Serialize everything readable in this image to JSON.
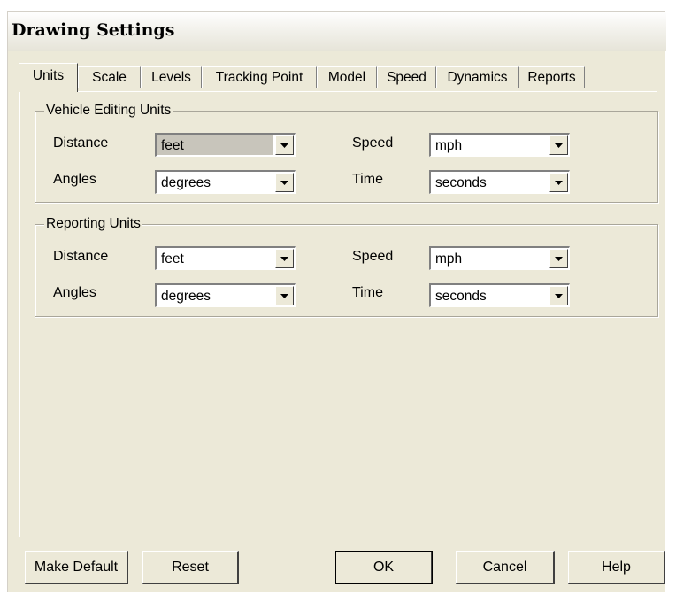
{
  "window": {
    "title": "Drawing Settings"
  },
  "tabs": [
    {
      "label": "Units",
      "active": true
    },
    {
      "label": "Scale"
    },
    {
      "label": "Levels"
    },
    {
      "label": "Tracking Point"
    },
    {
      "label": "Model"
    },
    {
      "label": "Speed"
    },
    {
      "label": "Dynamics"
    },
    {
      "label": "Reports"
    }
  ],
  "vehicle_editing_units": {
    "legend": "Vehicle Editing Units",
    "distance": {
      "label": "Distance",
      "value": "feet"
    },
    "angles": {
      "label": "Angles",
      "value": "degrees"
    },
    "speed": {
      "label": "Speed",
      "value": "mph"
    },
    "time": {
      "label": "Time",
      "value": "seconds"
    }
  },
  "reporting_units": {
    "legend": "Reporting Units",
    "distance": {
      "label": "Distance",
      "value": "feet"
    },
    "angles": {
      "label": "Angles",
      "value": "degrees"
    },
    "speed": {
      "label": "Speed",
      "value": "mph"
    },
    "time": {
      "label": "Time",
      "value": "seconds"
    }
  },
  "buttons": {
    "make_default": "Make Default",
    "reset": "Reset",
    "ok": "OK",
    "cancel": "Cancel",
    "help": "Help"
  },
  "icons": {
    "dropdown": "chevron-down-icon"
  },
  "colors": {
    "dialog_bg": "#ece9d8",
    "highlight": "#c8c5bb"
  }
}
